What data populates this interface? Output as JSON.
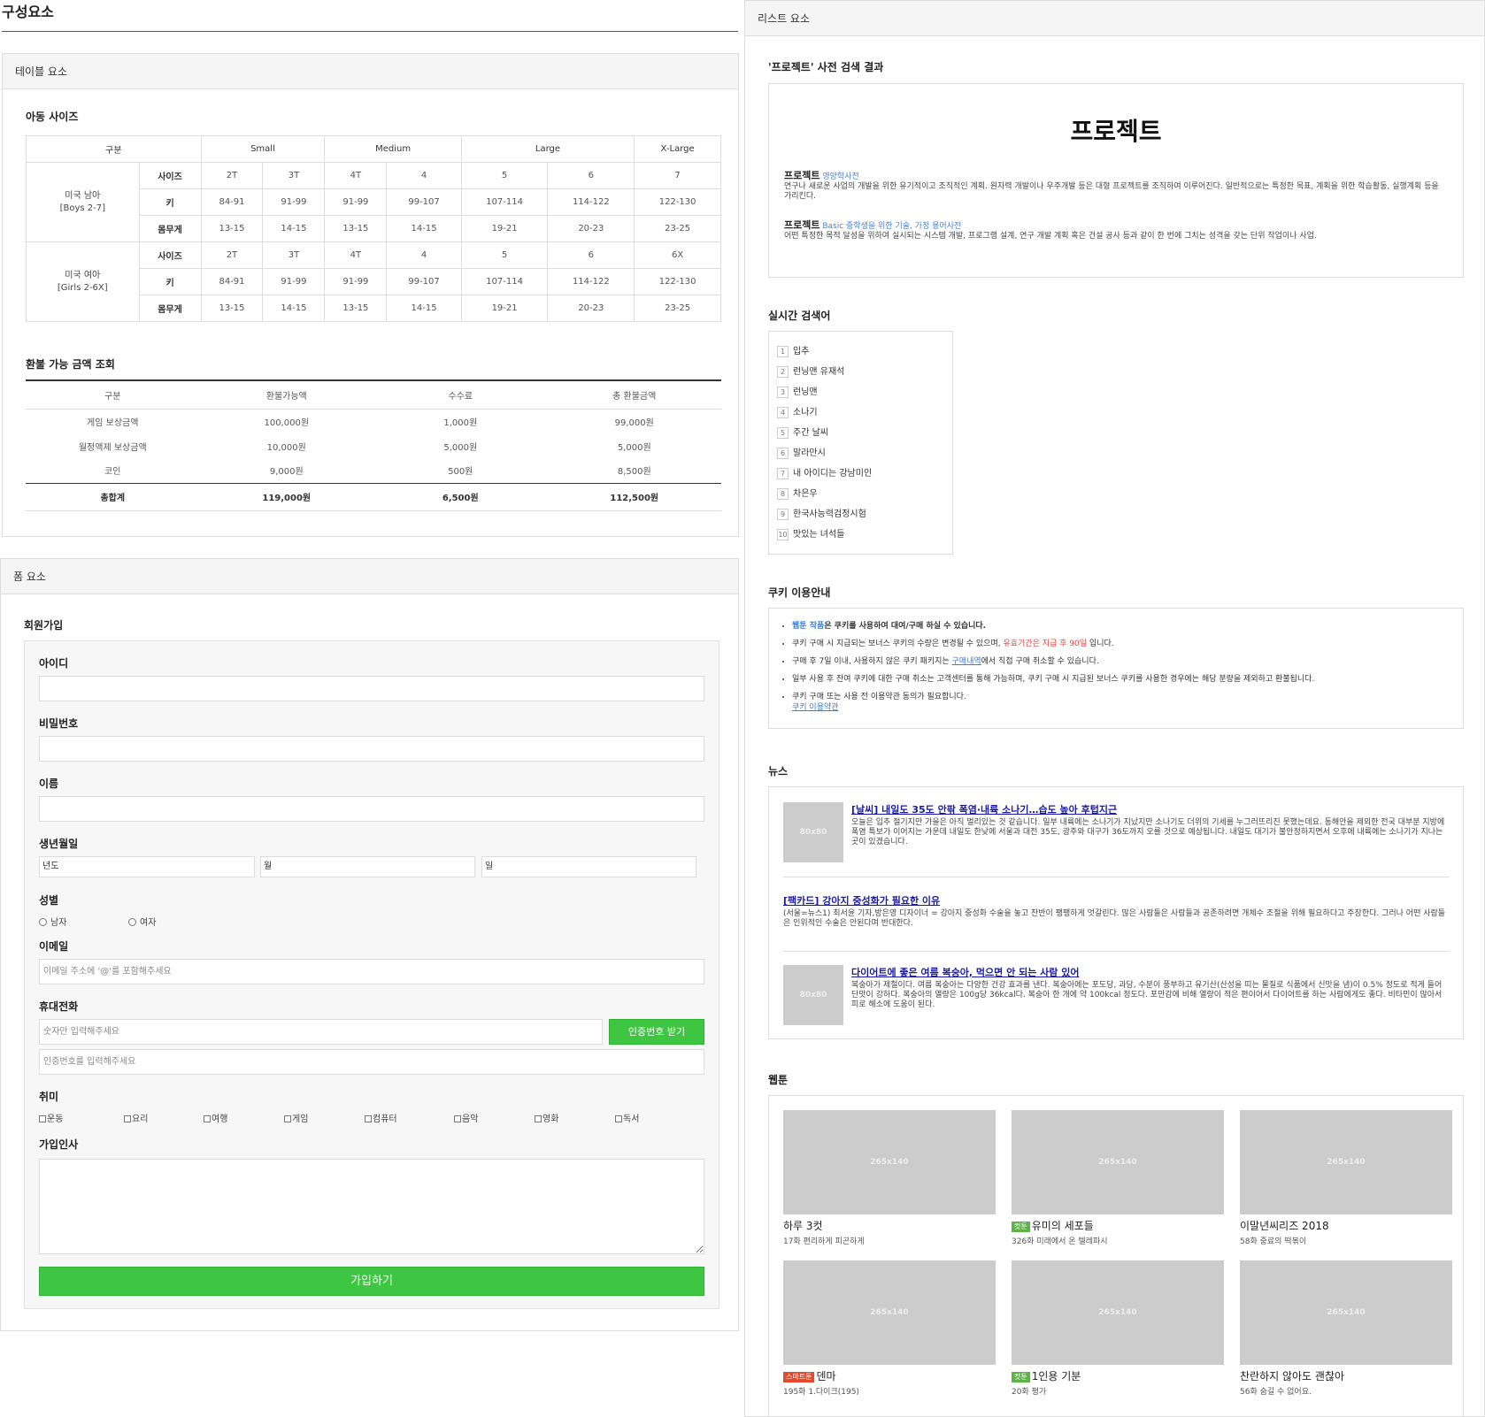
{
  "page": {
    "title": "구성요소"
  },
  "table_panel": {
    "heading": "테이블 요소",
    "size": {
      "title": "아동 사이즈",
      "header": [
        "구분",
        "Small",
        "Medium",
        "Large",
        "X-Large"
      ],
      "groups": [
        {
          "name": "미국 남아",
          "sub": "[Boys 2-7]",
          "rows": [
            {
              "label": "사이즈",
              "cells": [
                "2T",
                "3T",
                "4T",
                "4",
                "5",
                "6",
                "7"
              ]
            },
            {
              "label": "키",
              "cells": [
                "84-91",
                "91-99",
                "91-99",
                "99-107",
                "107-114",
                "114-122",
                "122-130"
              ]
            },
            {
              "label": "몸무게",
              "cells": [
                "13-15",
                "14-15",
                "13-15",
                "14-15",
                "19-21",
                "20-23",
                "23-25"
              ]
            }
          ]
        },
        {
          "name": "미국 여아",
          "sub": "[Girls 2-6X]",
          "rows": [
            {
              "label": "사이즈",
              "cells": [
                "2T",
                "3T",
                "4T",
                "4",
                "5",
                "6",
                "6X"
              ]
            },
            {
              "label": "키",
              "cells": [
                "84-91",
                "91-99",
                "91-99",
                "99-107",
                "107-114",
                "114-122",
                "122-130"
              ]
            },
            {
              "label": "몸무게",
              "cells": [
                "13-15",
                "14-15",
                "13-15",
                "14-15",
                "19-21",
                "20-23",
                "23-25"
              ]
            }
          ]
        }
      ]
    },
    "refund": {
      "title": "환불 가능 금액 조회",
      "header": [
        "구분",
        "환불가능액",
        "수수료",
        "총 환불금액"
      ],
      "rows": [
        [
          "게임 보상금액",
          "100,000원",
          "1,000원",
          "99,000원"
        ],
        [
          "월정액제 보상금액",
          "10,000원",
          "5,000원",
          "5,000원"
        ],
        [
          "코인",
          "9,000원",
          "500원",
          "8,500원"
        ]
      ],
      "total": [
        "총합계",
        "119,000원",
        "6,500원",
        "112,500원"
      ]
    }
  },
  "form_panel": {
    "heading": "폼 요소",
    "title": "회원가입",
    "id_label": "아이디",
    "pw_label": "비밀번호",
    "name_label": "이름",
    "birth_label": "생년월일",
    "birth_year": "년도",
    "birth_month": "월",
    "birth_day": "일",
    "gender_label": "성별",
    "gender_male": "남자",
    "gender_female": "여자",
    "email_label": "이메일",
    "email_placeholder": "이메일 주소에 '@'를 포함해주세요",
    "phone_label": "휴대전화",
    "phone_placeholder": "숫자만 입력해주세요",
    "phone_button": "인증번호 받기",
    "code_placeholder": "인증번호를 입력해주세요",
    "hobby_label": "취미",
    "hobbies": [
      "운동",
      "요리",
      "여행",
      "게임",
      "컴퓨터",
      "음악",
      "영화",
      "독서"
    ],
    "greeting_label": "가입인사",
    "submit": "가입하기"
  },
  "list_panel": {
    "heading": "리스트 요소",
    "dict": {
      "title": "'프로젝트' 사전 검색 결과",
      "word": "프로젝트",
      "entries": [
        {
          "term": "프로젝트",
          "source": "영양학사전",
          "text": "연구나 새로운 사업의 개발을 위한 유기적이고 조직적인 계획. 원자력 개발이나 우주개발 등은 대형 프로젝트를 조직하여 이루어진다. 일반적으로는 특정한 목표, 계획을 위한 학습활동, 실행계획 등을 가리킨다."
        },
        {
          "term": "프로젝트",
          "source": "Basic 중학생을 위한 기술, 가정 용어사전",
          "text": "어떤 특정한 목적 달성을 위하여 실시되는 시스템 개발, 프로그램 설계, 연구 개발 계획 혹은 건설 공사 등과 같이 한 번에 그치는 성격을 갖는 단위 작업이나 사업."
        }
      ]
    },
    "rank": {
      "title": "실시간 검색어",
      "items": [
        {
          "num": "1",
          "text": "입추"
        },
        {
          "num": "2",
          "text": "런닝맨 유재석"
        },
        {
          "num": "3",
          "text": "런닝맨"
        },
        {
          "num": "4",
          "text": "소나기"
        },
        {
          "num": "5",
          "text": "주간 날씨"
        },
        {
          "num": "6",
          "text": "말라만시"
        },
        {
          "num": "7",
          "text": "내 아이디는 강남미인"
        },
        {
          "num": "8",
          "text": "차은우"
        },
        {
          "num": "9",
          "text": "한국사능력검정시험"
        },
        {
          "num": "10",
          "text": "맛있는 녀석들"
        }
      ]
    },
    "cookie": {
      "title": "쿠키 이용안내",
      "item1_link": "웹툰 작품",
      "item1_rest": "은 쿠키를 사용하여 대여/구매 하실 수 있습니다.",
      "item2_pre": "쿠키 구매 시 지급되는 보너스 쿠키의 수량은 변경될 수 있으며, ",
      "item2_red": "유효기간은 지급 후 90일",
      "item2_post": " 입니다.",
      "item3_pre": "구매 후 7일 이내, 사용하지 않은 쿠키 패키지는 ",
      "item3_link": "구매내역",
      "item3_post": "에서 직접 구매 취소할 수 있습니다.",
      "item4": "일부 사용 후 잔여 쿠키에 대한 구매 취소는 고객센터를 통해 가능하며, 쿠키 구매 시 지급된 보너스 쿠키를 사용한 경우에는 해당 분량을 제외하고 환불됩니다.",
      "item5": "쿠키 구매 또는 사용 전 이용약관 동의가 필요합니다.",
      "item5_link": "쿠키 이용약관"
    },
    "news": {
      "title": "뉴스",
      "thumb_label": "80x80",
      "items": [
        {
          "headline": "[날씨] 내일도 35도 안팎 폭염·내륙 소나기…습도 높아 후텁지근",
          "body": "오늘은 입추 절기지만 가을은 아직 멀리있는 것 같습니다. 일부 내륙에는 소나기가 지났지만 소나기도 더위의 기세를 누그러뜨리진 못했는데요. 동해안을 제외한 전국 대부분 지방에 폭염 특보가 이어지는 가운데 내일도 한낮에 서울과 대전 35도, 광주와 대구가 36도까지 오를 것으로 예상됩니다. 내일도 대기가 불안정하지면서 오후에 내륙에는 소나기가 지나는 곳이 있겠습니다."
        },
        {
          "headline": "[팩카드] 강아지 중성화가 필요한 이유",
          "body": "(서울=뉴스1) 최서윤 기자,방은영 디자이너 = 강아지 중성화 수술을 놓고 찬반이 팽팽하게 엇갈린다. 많은 사람들은 사람들과 공존하려면 개체수 조절을 위해 필요하다고 주장한다. 그러나 어떤 사람들은 인위적인 수술은 안된다며 반대한다."
        },
        {
          "headline": "다이어트에 좋은 여름 복숭아, 먹으면 안 되는 사람 있어",
          "body": "복숭아가 제철이다. 여름 복숭아는 다양한 건강 효과를 낸다. 복숭아에는 포도당, 과당, 수분이 풍부하고 유기산(산성을 띠는 물질로 식품에서 신맛을 냄)이 0.5% 정도로 적게 들어 단맛이 강하다. 복숭아의 열량은 100g당 36kcal다. 복숭아 한 개에 약 100kcal 정도다. 포만감에 비해 열량이 적은 편이어서 다이어트를 하는 사람에게도 좋다. 비타민이 많아서 피로 해소에 도움이 된다."
        }
      ]
    },
    "webtoon": {
      "title": "웹툰",
      "thumb_label": "265x140",
      "items": [
        {
          "badge": "",
          "title": "하루 3컷",
          "meta": "17화 편리하게 피곤하게"
        },
        {
          "badge": "컷툰",
          "title": "유미의 세포들",
          "meta": "326화 미래에서 온 텔레파시"
        },
        {
          "badge": "",
          "title": "이말년씨리즈 2018",
          "meta": "58화 중료의 떡볶이"
        },
        {
          "badge": "스마트툰",
          "title": "덴마",
          "meta": "195화 1.다이크(195)"
        },
        {
          "badge": "컷툰",
          "title": "1인용 기분",
          "meta": "20화 평가"
        },
        {
          "badge": "",
          "title": "찬란하지 않아도 괜찮아",
          "meta": "56화 숨길 수 없어요."
        }
      ],
      "badge_colors": {
        "컷툰": "#5bb445",
        "스마트툰": "#e5492b"
      }
    }
  },
  "colors": {
    "accent_green": "#3ec541",
    "link_blue": "#3a7bd5",
    "border": "#dddddd"
  }
}
